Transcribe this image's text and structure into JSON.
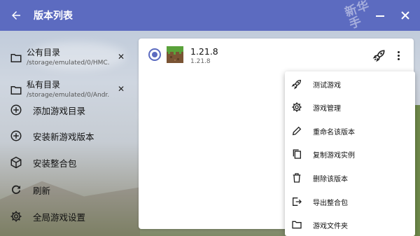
{
  "app": {
    "title": "版本列表",
    "watermark": "新华手"
  },
  "colors": {
    "primary": "#5c6bc0",
    "card_bg": "#ffffff",
    "text": "#111111"
  },
  "sidebar": {
    "directories": [
      {
        "name": "公有目录",
        "path": "/storage/emulated/0/HMC...",
        "icon": "folder-icon",
        "close_icon": "close-icon"
      },
      {
        "name": "私有目录",
        "path": "/storage/emulated/0/Andr...",
        "icon": "folder-icon",
        "close_icon": "close-icon"
      }
    ],
    "actions": [
      {
        "label": "添加游戏目录",
        "icon": "add-circle-icon"
      },
      {
        "label": "安装新游戏版本",
        "icon": "add-circle-icon"
      },
      {
        "label": "安装整合包",
        "icon": "package-icon"
      },
      {
        "label": "刷新",
        "icon": "refresh-icon"
      },
      {
        "label": "全局游戏设置",
        "icon": "gear-icon"
      }
    ]
  },
  "version": {
    "name": "1.21.8",
    "subtitle": "1.21.8",
    "selected": true,
    "icon": "grass-block-icon"
  },
  "menu": {
    "items": [
      {
        "label": "测试游戏",
        "icon": "rocket-icon"
      },
      {
        "label": "游戏管理",
        "icon": "gear-icon"
      },
      {
        "label": "重命名该版本",
        "icon": "pencil-icon"
      },
      {
        "label": "复制游戏实例",
        "icon": "copy-icon"
      },
      {
        "label": "删除该版本",
        "icon": "trash-icon"
      },
      {
        "label": "导出整合包",
        "icon": "export-icon"
      },
      {
        "label": "游戏文件夹",
        "icon": "folder-icon"
      }
    ]
  }
}
